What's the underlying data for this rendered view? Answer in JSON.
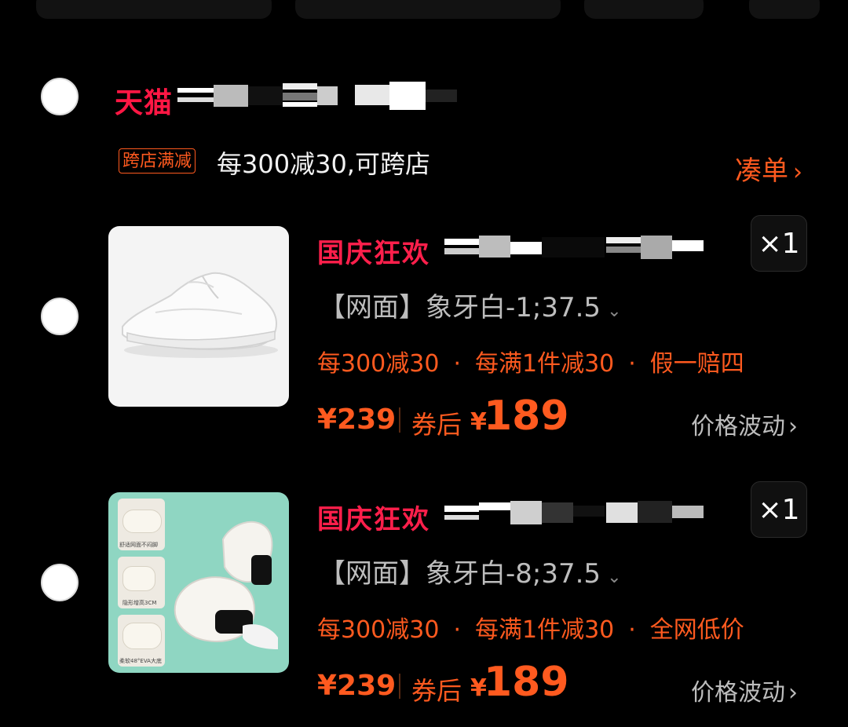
{
  "store": {
    "logo": "天猫",
    "promo_tag": "跨店满减",
    "promo_text": "每300减30,可跨店",
    "coudan": "凑单",
    "chevron": "›"
  },
  "items": [
    {
      "event": "国庆狂欢",
      "qty": "×1",
      "sku": "【网面】象牙白-1;37.5",
      "sku_caret": "⌄",
      "tags": [
        "每300减30",
        "每满1件减30",
        "假一赔四"
      ],
      "price_orig": "¥239",
      "after_label": "券后",
      "after_currency": "¥",
      "after_price": "189",
      "trend": "价格波动",
      "trend_chevron": "›"
    },
    {
      "event": "国庆狂欢",
      "qty": "×1",
      "sku": "【网面】象牙白-8;37.5",
      "sku_caret": "⌄",
      "tags": [
        "每300减30",
        "每满1件减30",
        "全网低价"
      ],
      "price_orig": "¥239",
      "after_label": "券后",
      "after_currency": "¥",
      "after_price": "189",
      "trend": "价格波动",
      "trend_chevron": "›",
      "image_labels": [
        "舒适网面不闷脚",
        "隐形增高3CM",
        "柔软48°EVA大底"
      ]
    }
  ],
  "colors": {
    "tmall_red": "#ff1744",
    "accent_orange": "#ff5a1f",
    "event_red": "#ff1f4b",
    "background": "#000000"
  },
  "icons": {
    "radio": "radio-unchecked-icon",
    "chevron": "chevron-right-icon",
    "caret": "chevron-down-icon"
  }
}
